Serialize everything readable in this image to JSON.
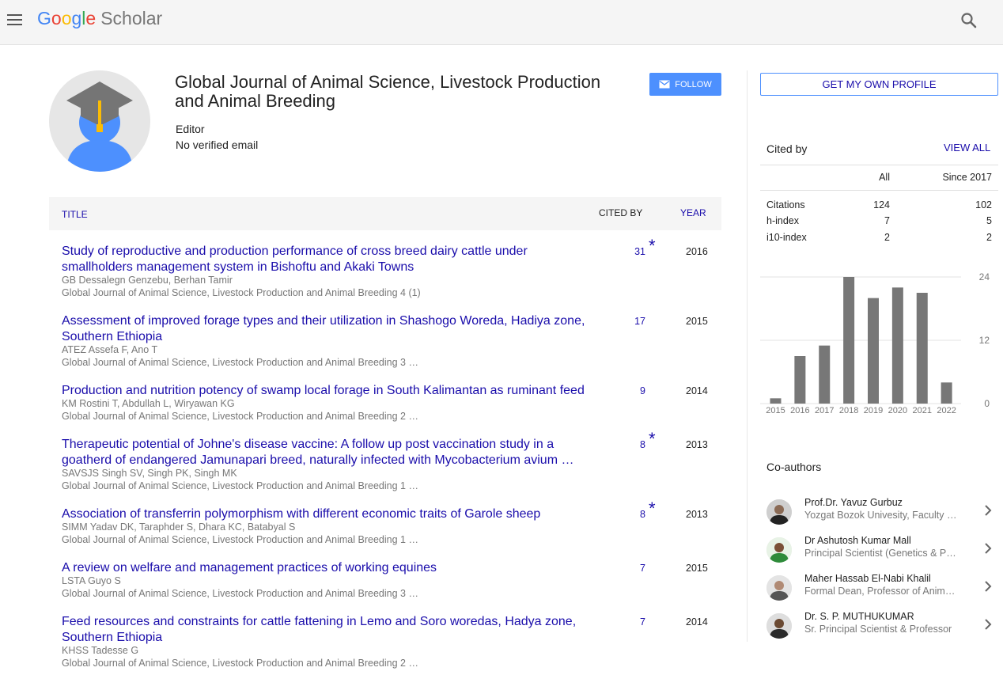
{
  "app": {
    "logo_google": [
      "G",
      "o",
      "o",
      "g",
      "l",
      "e"
    ],
    "logo_scholar": "Scholar"
  },
  "profile": {
    "name": "Global Journal of Animal Science, Livestock Production and Animal Breeding",
    "affiliation": "Editor",
    "email": "No verified email",
    "follow_label": "FOLLOW"
  },
  "table": {
    "col_title": "TITLE",
    "col_cited": "CITED BY",
    "col_year": "YEAR",
    "rows": [
      {
        "title": "Study of reproductive and production performance of cross breed dairy cattle under smallholders management system in Bishoftu and Akaki Towns",
        "authors": "GB Dessalegn Genzebu, Berhan Tamir",
        "venue": "Global Journal of Animal Science, Livestock Production and Animal Breeding 4 (1)",
        "cited": "31",
        "star": "*",
        "year": "2016"
      },
      {
        "title": "Assessment of improved forage types and their utilization in Shashogo Woreda, Hadiya zone, Southern Ethiopia",
        "authors": "ATEZ Assefa F, Ano T",
        "venue": "Global Journal of Animal Science, Livestock Production and Animal Breeding 3 …",
        "cited": "17",
        "star": "",
        "year": "2015"
      },
      {
        "title": "Production and nutrition potency of swamp local forage in South Kalimantan as ruminant feed",
        "authors": "KM Rostini T, Abdullah L, Wiryawan KG",
        "venue": "Global Journal of Animal Science, Livestock Production and Animal Breeding 2 …",
        "cited": "9",
        "star": "",
        "year": "2014"
      },
      {
        "title": "Therapeutic potential of Johne's disease vaccine: A follow up post vaccination study in a goatherd of endangered Jamunapari breed, naturally infected with Mycobacterium avium …",
        "authors": "SAVSJS Singh SV, Singh PK, Singh MK",
        "venue": "Global Journal of Animal Science, Livestock Production and Animal Breeding 1 …",
        "cited": "8",
        "star": "*",
        "year": "2013"
      },
      {
        "title": "Association of transferrin polymorphism with different economic traits of Garole sheep",
        "authors": "SIMM Yadav DK, Taraphder S, Dhara KC, Batabyal S",
        "venue": "Global Journal of Animal Science, Livestock Production and Animal Breeding 1 …",
        "cited": "8",
        "star": "*",
        "year": "2013"
      },
      {
        "title": "A review on welfare and management practices of working equines",
        "authors": "LSTA Guyo S",
        "venue": "Global Journal of Animal Science, Livestock Production and Animal Breeding 3 …",
        "cited": "7",
        "star": "",
        "year": "2015"
      },
      {
        "title": "Feed resources and constraints for cattle fattening in Lemo and Soro woredas, Hadya zone, Southern Ethiopia",
        "authors": "KHSS Tadesse G",
        "venue": "Global Journal of Animal Science, Livestock Production and Animal Breeding 2 …",
        "cited": "7",
        "star": "",
        "year": "2014"
      }
    ]
  },
  "sidebar": {
    "own_profile_label": "GET MY OWN PROFILE",
    "cited_by_title": "Cited by",
    "view_all_label": "VIEW ALL",
    "stats_head_all": "All",
    "stats_head_since": "Since 2017",
    "stats": [
      {
        "label": "Citations",
        "all": "124",
        "since": "102"
      },
      {
        "label": "h-index",
        "all": "7",
        "since": "5"
      },
      {
        "label": "i10-index",
        "all": "2",
        "since": "2"
      }
    ],
    "coauthors_title": "Co-authors",
    "coauthors": [
      {
        "name": "Prof.Dr. Yavuz Gurbuz",
        "affiliation": "Yozgat Bozok Univesity, Faculty …"
      },
      {
        "name": "Dr Ashutosh Kumar Mall",
        "affiliation": "Principal Scientist (Genetics & P…"
      },
      {
        "name": "Maher Hassab El-Nabi Khalil",
        "affiliation": "Formal Dean, Professor of Anim…"
      },
      {
        "name": "Dr. S. P. MUTHUKUMAR",
        "affiliation": "Sr. Principal Scientist & Professor"
      }
    ]
  },
  "chart_data": {
    "type": "bar",
    "categories": [
      "2015",
      "2016",
      "2017",
      "2018",
      "2019",
      "2020",
      "2021",
      "2022"
    ],
    "values": [
      1,
      9,
      11,
      24,
      20,
      22,
      21,
      4
    ],
    "ylim": [
      0,
      24
    ],
    "yticks": [
      "24",
      "12",
      "0"
    ],
    "grid": true,
    "bar_color": "#777777"
  }
}
